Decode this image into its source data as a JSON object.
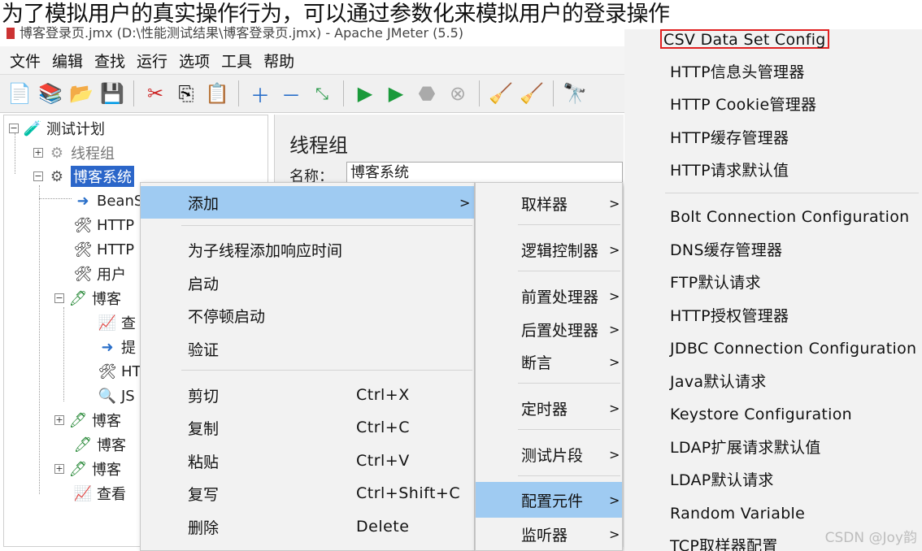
{
  "heading": "为了模拟用户的真实操作行为，可以通过参数化来模拟用户的登录操作",
  "window": {
    "title": "博客登录页.jmx (D:\\性能测试结果\\博客登录页.jmx) - Apache JMeter (5.5)"
  },
  "menubar": [
    "文件",
    "编辑",
    "查找",
    "运行",
    "选项",
    "工具",
    "帮助"
  ],
  "toolbar_icons": [
    "new-file-icon",
    "templates-icon",
    "open-icon",
    "save-icon",
    "cut-icon",
    "copy-icon",
    "paste-icon",
    "expand-icon",
    "collapse-icon",
    "toggle-icon",
    "start-icon",
    "start-no-pause-icon",
    "stop-icon",
    "shutdown-icon",
    "clear-icon",
    "clear-all-icon",
    "search-icon"
  ],
  "tree": {
    "root": "测试计划",
    "thread_group_1": "线程组",
    "thread_group_2": "博客系统",
    "children": [
      "BeanS",
      "HTTP",
      "HTTP",
      "用户",
      "博客",
      "查",
      "提",
      "HT",
      "JS",
      "博客",
      "博客",
      "博客",
      "查看"
    ]
  },
  "panel": {
    "title": "线程组",
    "name_label": "名称：",
    "name_value": "博客系统"
  },
  "menu1": {
    "add": "添加",
    "items_a": [
      "为子线程添加响应时间",
      "启动",
      "不停顿启动",
      "验证"
    ],
    "items_b": [
      {
        "label": "剪切",
        "acc": "Ctrl+X"
      },
      {
        "label": "复制",
        "acc": "Ctrl+C"
      },
      {
        "label": "粘贴",
        "acc": "Ctrl+V"
      },
      {
        "label": "复写",
        "acc": "Ctrl+Shift+C"
      },
      {
        "label": "删除",
        "acc": "Delete"
      }
    ]
  },
  "menu2": [
    "取样器",
    "逻辑控制器",
    "前置处理器",
    "后置处理器",
    "断言",
    "定时器",
    "测试片段",
    "配置元件",
    "监听器"
  ],
  "menu3": [
    "CSV Data Set Config",
    "HTTP信息头管理器",
    "HTTP Cookie管理器",
    "HTTP缓存管理器",
    "HTTP请求默认值",
    "Bolt Connection Configuration",
    "DNS缓存管理器",
    "FTP默认请求",
    "HTTP授权管理器",
    "JDBC Connection Configuration",
    "Java默认请求",
    "Keystore Configuration",
    "LDAP扩展请求默认值",
    "LDAP默认请求",
    "Random Variable",
    "TCP取样器配置"
  ],
  "watermark": "CSDN @Joy韵",
  "colors": {
    "highlight": "#9fcbf2",
    "selection": "#2b66c9",
    "callout": "#e02020"
  }
}
